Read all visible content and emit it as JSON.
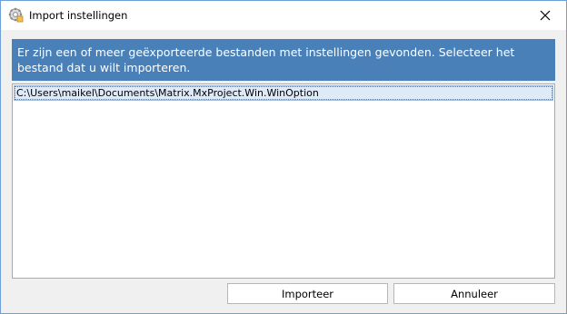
{
  "window": {
    "title": "Import instellingen",
    "icon": "gear-settings-icon",
    "close_icon": "close-icon"
  },
  "banner": {
    "text": "Er zijn een of meer geëxporteerde bestanden met instellingen gevonden. Selecteer het bestand dat u wilt importeren.",
    "color": "#4a80b8"
  },
  "file_list": {
    "items": [
      {
        "path": "C:\\Users\\maikel\\Documents\\Matrix.MxProject.Win.WinOption",
        "selected": true
      }
    ]
  },
  "buttons": {
    "import_label": "Importeer",
    "cancel_label": "Annuleer"
  }
}
